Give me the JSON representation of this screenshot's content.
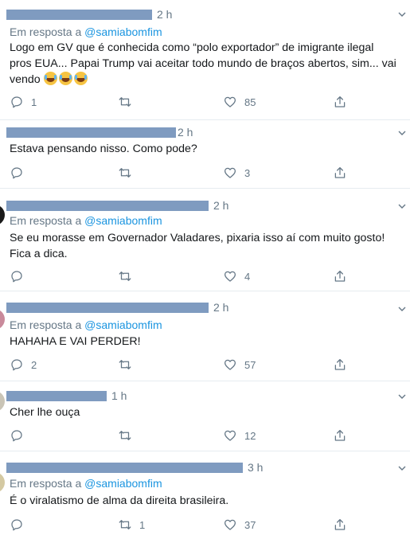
{
  "tweets": [
    {
      "time": "2 h",
      "reply_prefix": "Em resposta a",
      "reply_handle": "@samiabomfim",
      "text_lines": [
        "Logo em GV que é conhecida como “polo exportador” de imigrante ilegal",
        "pros EUA... Papai Trump vai aceitar todo mundo de braços abertos, sim... vai",
        "vendo"
      ],
      "emoji": "face-with-tears-of-joy",
      "replies": "1",
      "retweets": "",
      "likes": "85"
    },
    {
      "time": "2 h",
      "reply_prefix": "",
      "reply_handle": "",
      "text_lines": [
        "Estava pensando nisso. Como pode?"
      ],
      "replies": "",
      "retweets": "",
      "likes": "3"
    },
    {
      "time": "2 h",
      "reply_prefix": "Em resposta a",
      "reply_handle": "@samiabomfim",
      "text_lines": [
        "Se eu morasse em Governador Valadares, pixaria isso aí com muito gosto!",
        "Fica a dica."
      ],
      "replies": "",
      "retweets": "",
      "likes": "4"
    },
    {
      "time": "2 h",
      "reply_prefix": "Em resposta a",
      "reply_handle": "@samiabomfim",
      "text_lines": [
        "HAHAHA E VAI PERDER!"
      ],
      "replies": "2",
      "retweets": "",
      "likes": "57"
    },
    {
      "time": "1 h",
      "reply_prefix": "",
      "reply_handle": "",
      "text_lines": [
        "Cher lhe ouça"
      ],
      "replies": "",
      "retweets": "",
      "likes": "12"
    },
    {
      "time": "3 h",
      "reply_prefix": "Em resposta a",
      "reply_handle": "@samiabomfim",
      "text_lines": [
        "É o viralatismo de alma da direita brasileira."
      ],
      "replies": "",
      "retweets": "1",
      "likes": "37"
    }
  ],
  "colors": {
    "muted": "#657786",
    "link": "#1b95e0",
    "redaction": "#7f9bc0",
    "divider": "#e6ecf0"
  },
  "icons": [
    "reply-icon",
    "retweet-icon",
    "like-icon",
    "share-icon",
    "chevron-down-icon"
  ]
}
